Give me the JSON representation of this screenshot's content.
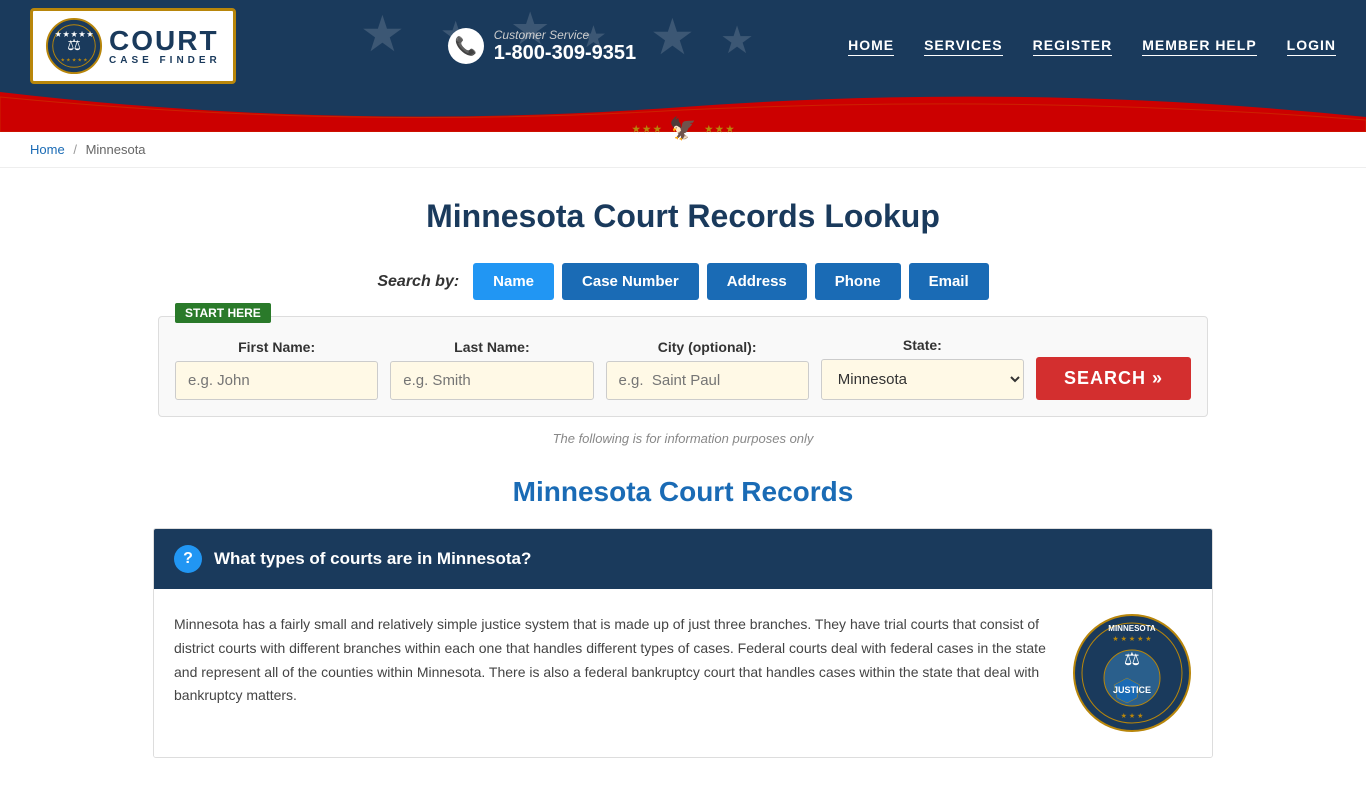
{
  "header": {
    "logo": {
      "icon_text": "⚖",
      "text_top": "COURT",
      "text_bottom": "CASE FINDER"
    },
    "customer_service": {
      "label": "Customer Service",
      "phone": "1-800-309-9351"
    },
    "nav": [
      {
        "label": "HOME",
        "id": "home"
      },
      {
        "label": "SERVICES",
        "id": "services"
      },
      {
        "label": "REGISTER",
        "id": "register"
      },
      {
        "label": "MEMBER HELP",
        "id": "member-help"
      },
      {
        "label": "LOGIN",
        "id": "login"
      }
    ]
  },
  "breadcrumb": {
    "home_label": "Home",
    "current": "Minnesota"
  },
  "main": {
    "title": "Minnesota Court Records Lookup",
    "search": {
      "search_by_label": "Search by:",
      "tabs": [
        {
          "label": "Name",
          "active": true
        },
        {
          "label": "Case Number"
        },
        {
          "label": "Address"
        },
        {
          "label": "Phone"
        },
        {
          "label": "Email"
        }
      ],
      "start_here": "START HERE",
      "fields": {
        "first_name": {
          "label": "First Name:",
          "placeholder": "e.g. John"
        },
        "last_name": {
          "label": "Last Name:",
          "placeholder": "e.g. Smith"
        },
        "city": {
          "label": "City (optional):",
          "placeholder": "e.g.  Saint Paul"
        },
        "state": {
          "label": "State:",
          "default": "Minnesota"
        }
      },
      "button": "SEARCH »",
      "disclaimer": "The following is for information purposes only"
    },
    "section_title": "Minnesota Court Records",
    "faq": [
      {
        "question": "What types of courts are in Minnesota?",
        "answer": "Minnesota has a fairly small and relatively simple justice system that is made up of just three branches. They have trial courts that consist of district courts with different branches within each one that handles different types of cases. Federal courts deal with federal cases in the state and represent all of the counties within Minnesota. There is also a federal bankruptcy court that handles cases within the state that deal with bankruptcy matters."
      }
    ]
  },
  "colors": {
    "primary_dark": "#1a3a5c",
    "primary_blue": "#1a6bb5",
    "accent_red": "#d32f2f",
    "tab_blue": "#2196F3",
    "green": "#2a7a2a"
  }
}
